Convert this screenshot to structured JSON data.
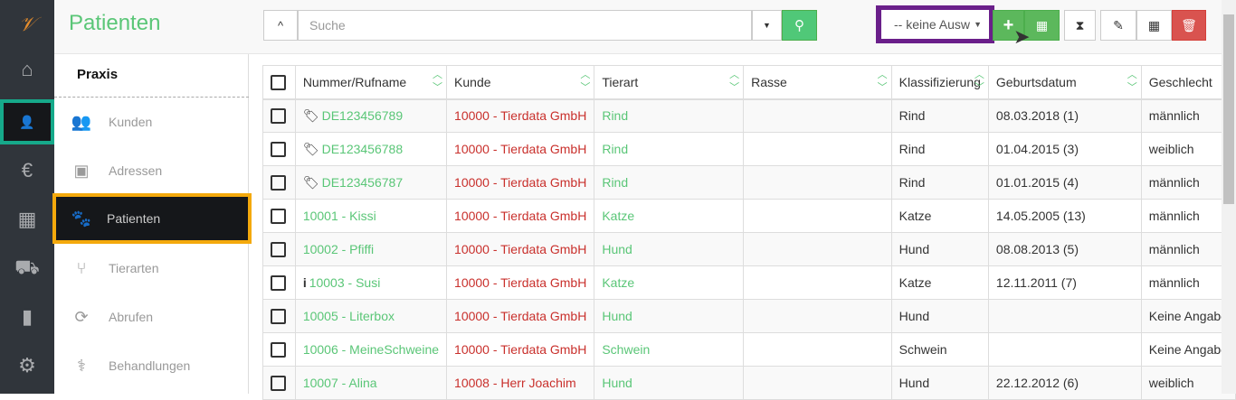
{
  "header": {
    "title": "Patienten",
    "search_placeholder": "Suche",
    "select_value": "-- keine Ausw"
  },
  "rail": [
    "home-icon",
    "user-doctor-icon",
    "euro-icon",
    "calendar-icon",
    "truck-icon",
    "book-icon",
    "gears-icon"
  ],
  "submenu": {
    "heading": "Praxis",
    "items": [
      {
        "label": "Kunden",
        "icon": "users-icon"
      },
      {
        "label": "Adressen",
        "icon": "address-book-icon"
      },
      {
        "label": "Patienten",
        "icon": "paw-icon"
      },
      {
        "label": "Tierarten",
        "icon": "code-branch-icon"
      },
      {
        "label": "Abrufen",
        "icon": "sync-icon"
      },
      {
        "label": "Behandlungen",
        "icon": "stethoscope-icon"
      }
    ]
  },
  "table": {
    "columns": [
      "Nummer/Rufname",
      "Kunde",
      "Tierart",
      "Rasse",
      "Klassifizierung",
      "Geburtsdatum",
      "Geschlecht"
    ],
    "rows": [
      [
        "DE123456789",
        "10000 - Tierdata GmbH",
        "Rind",
        "",
        "Rind",
        "08.03.2018 (1)",
        "männlich",
        "tag"
      ],
      [
        "DE123456788",
        "10000 - Tierdata GmbH",
        "Rind",
        "",
        "Rind",
        "01.04.2015 (3)",
        "weiblich",
        "tag"
      ],
      [
        "DE123456787",
        "10000 - Tierdata GmbH",
        "Rind",
        "",
        "Rind",
        "01.01.2015 (4)",
        "männlich",
        "tag"
      ],
      [
        "10001 - Kissi",
        "10000 - Tierdata GmbH",
        "Katze",
        "",
        "Katze",
        "14.05.2005 (13)",
        "männlich",
        ""
      ],
      [
        "10002 - Pfiffi",
        "10000 - Tierdata GmbH",
        "Hund",
        "",
        "Hund",
        "08.08.2013 (5)",
        "männlich",
        ""
      ],
      [
        "10003 - Susi",
        "10000 - Tierdata GmbH",
        "Katze",
        "",
        "Katze",
        "12.11.2011 (7)",
        "männlich",
        "info"
      ],
      [
        "10005 - Literbox",
        "10000 - Tierdata GmbH",
        "Hund",
        "",
        "Hund",
        "",
        "Keine Angabe",
        ""
      ],
      [
        "10006 - MeineSchweine",
        "10000 - Tierdata GmbH",
        "Schwein",
        "",
        "Schwein",
        "",
        "Keine Angabe",
        ""
      ],
      [
        "10007 - Alina",
        "10008 - Herr Joachim",
        "Hund",
        "",
        "Hund",
        "22.12.2012 (6)",
        "weiblich",
        ""
      ]
    ]
  }
}
